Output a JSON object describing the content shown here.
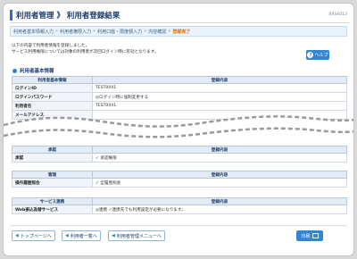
{
  "header": {
    "title": "利用者管理 》 利用者登録結果",
    "screen_id": "BRSK013"
  },
  "steps": [
    {
      "label": "利用者基本情報入力",
      "active": false
    },
    {
      "label": "利用者権限入力",
      "active": false
    },
    {
      "label": "利用口座・限度額入力",
      "active": false
    },
    {
      "label": "内容確認",
      "active": false
    },
    {
      "label": "登録完了",
      "active": true
    }
  ],
  "step_separator": "»",
  "intro": {
    "line1": "以下の内容で利用者情報を登録しました。",
    "line2": "サービス利用権限については対象の利用者が次回ログイン時に有効となります。"
  },
  "help": {
    "label": "ヘルプ",
    "icon": "help-icon"
  },
  "basic_info": {
    "heading": "利用者基本情報",
    "col_item": "利用者基本情報",
    "col_value": "登録内容",
    "rows": [
      {
        "label": "ログインID",
        "value": "TEST0041"
      },
      {
        "label": "ログインパスワード",
        "value": "◎ログイン時に強制変更する"
      },
      {
        "label": "利用者名",
        "value": "TEST0041"
      },
      {
        "label": "メールアドレス",
        "value": ""
      }
    ]
  },
  "table2": {
    "col_item": "承認",
    "col_value": "登録内容",
    "rows": [
      {
        "label": "承認",
        "value": "✓ 承認権限"
      }
    ]
  },
  "table3": {
    "col_item": "管理",
    "col_value": "登録内容",
    "rows": [
      {
        "label": "操作履歴照会",
        "value": "✓ 全履歴照会"
      }
    ]
  },
  "table4": {
    "col_item": "サービス連携",
    "col_value": "登録内容",
    "rows": [
      {
        "label": "Web振込為替サービス",
        "value": "◎連携 ✓連携先でも利用設定が必要になります。"
      }
    ]
  },
  "footer": {
    "top_button": "トップページへ",
    "list_button": "利用者一覧へ",
    "menu_button": "利用者管理メニューへ",
    "print_button": "印刷"
  },
  "colors": {
    "accent": "#2f86d6",
    "active_step": "#e66a00",
    "heading": "#1d3c6e"
  }
}
